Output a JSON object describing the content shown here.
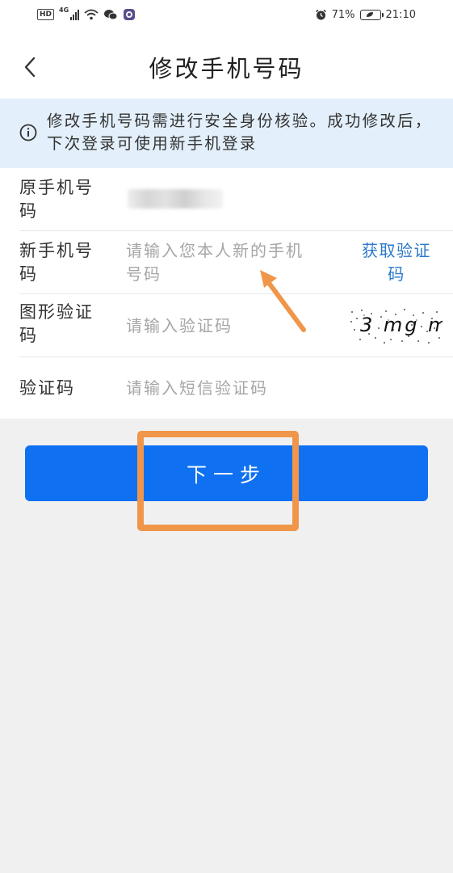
{
  "status_bar": {
    "hd": "HD",
    "network": "4G",
    "battery_percent": "71%",
    "time": "21:10",
    "icons": [
      "signal-icon",
      "wifi-icon",
      "wechat-icon",
      "app-icon",
      "alarm-icon",
      "battery-icon"
    ]
  },
  "header": {
    "back_icon": "chevron-left-icon",
    "title": "修改手机号码"
  },
  "notice": {
    "icon": "info-icon",
    "text": "修改手机号码需进行安全身份核验。成功修改后，下次登录可使用新手机登录"
  },
  "form": {
    "original_phone": {
      "label": "原手机号码"
    },
    "new_phone": {
      "label": "新手机号码",
      "placeholder": "请输入您本人新的手机号码",
      "action": "获取验证码"
    },
    "captcha": {
      "label": "图形验证码",
      "placeholder": "请输入验证码",
      "image_text": "3 mg m"
    },
    "sms_code": {
      "label": "验证码",
      "placeholder": "请输入短信验证码"
    }
  },
  "next_button": {
    "label": "下一步"
  },
  "colors": {
    "accent": "#0f71f2",
    "link": "#2b79c9",
    "notice_bg": "#e3effa",
    "annotation": "#f0964a",
    "page_bg": "#f0f0f0"
  }
}
